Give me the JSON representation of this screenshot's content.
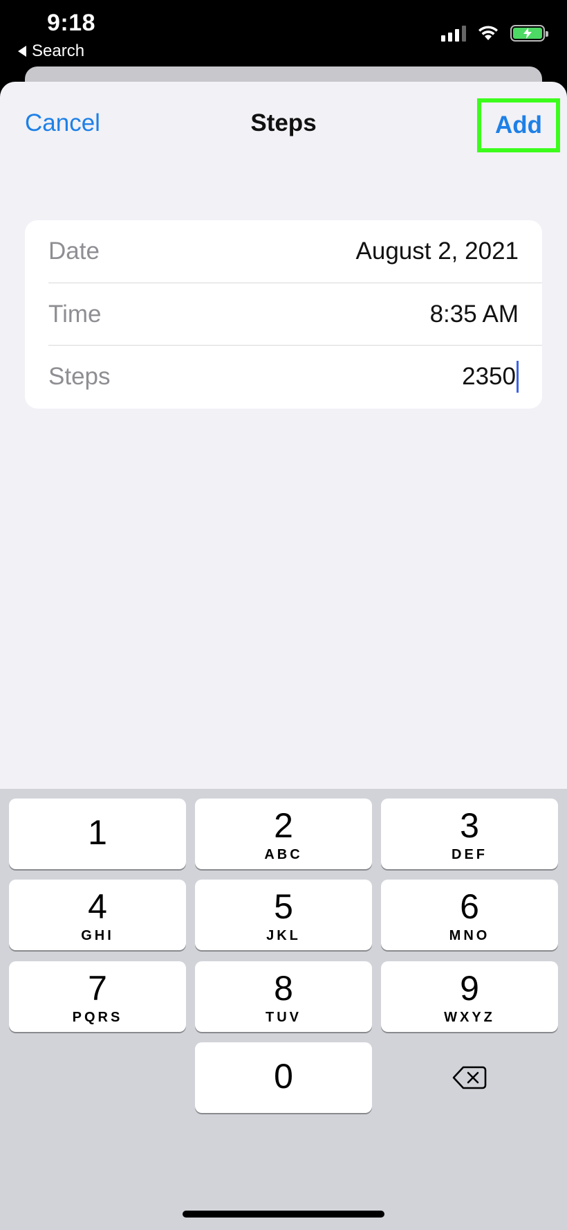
{
  "status_bar": {
    "time": "9:18",
    "back_label": "Search",
    "icons": [
      "signal-icon",
      "wifi-icon",
      "battery-charging-icon"
    ],
    "battery_color": "#4cd964"
  },
  "nav": {
    "cancel_label": "Cancel",
    "title": "Steps",
    "add_label": "Add",
    "accent_color": "#1e80e6"
  },
  "form": {
    "rows": [
      {
        "label": "Date",
        "value": "August 2, 2021"
      },
      {
        "label": "Time",
        "value": "8:35 AM"
      },
      {
        "label": "Steps",
        "value": "2350"
      }
    ]
  },
  "keypad": {
    "keys": [
      {
        "digit": "1",
        "letters": ""
      },
      {
        "digit": "2",
        "letters": "ABC"
      },
      {
        "digit": "3",
        "letters": "DEF"
      },
      {
        "digit": "4",
        "letters": "GHI"
      },
      {
        "digit": "5",
        "letters": "JKL"
      },
      {
        "digit": "6",
        "letters": "MNO"
      },
      {
        "digit": "7",
        "letters": "PQRS"
      },
      {
        "digit": "8",
        "letters": "TUV"
      },
      {
        "digit": "9",
        "letters": "WXYZ"
      },
      {
        "digit": "0",
        "letters": ""
      }
    ],
    "delete_icon": "backspace-icon"
  }
}
